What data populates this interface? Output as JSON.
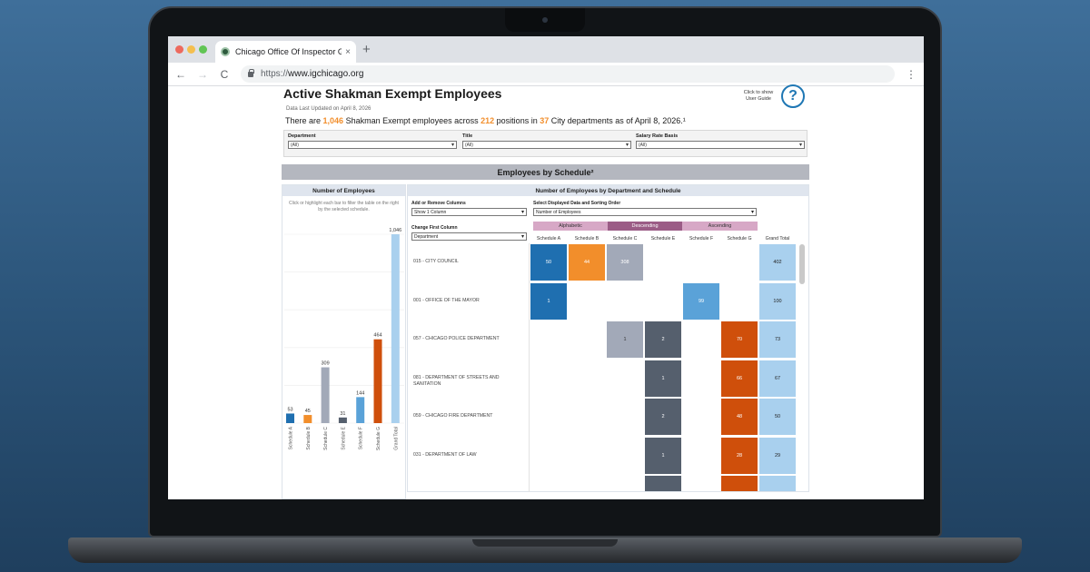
{
  "browser": {
    "tab_title": "Chicago Office Of Inspector General",
    "url_scheme": "https://",
    "url_host": "www.igchicago.org",
    "new_tab": "+",
    "tab_close": "×",
    "back": "←",
    "forward": "→",
    "reload": "C",
    "menu": "⋮"
  },
  "page": {
    "title": "Active Shakman Exempt Employees",
    "updated": "Data Last Updated on April 8, 2026",
    "summary": {
      "pre": "There are ",
      "employees": "1,046",
      "mid1": " Shakman Exempt employees across ",
      "positions": "212",
      "mid2": " positions in ",
      "departments": "37",
      "post": " City departments as of April 8, 2026.¹"
    },
    "guide_text": "Click to show User Guide",
    "help_icon": "?"
  },
  "filters": [
    {
      "label": "Department",
      "value": "(All)"
    },
    {
      "label": "Title",
      "value": "(All)"
    },
    {
      "label": "Salary Rate Basis",
      "value": "(All)"
    }
  ],
  "section_title": "Employees by Schedule²",
  "left_panel": {
    "title": "Number of Employees",
    "note": "Click or highlight each bar to filter the table on the right by the selected schedule."
  },
  "chart_data": {
    "type": "bar",
    "categories": [
      "Schedule A",
      "Schedule B",
      "Schedule C",
      "Schedule E",
      "Schedule F",
      "Schedule G",
      "Grand Total"
    ],
    "values": [
      53,
      45,
      309,
      31,
      144,
      464,
      1046
    ],
    "labels": [
      "53",
      "45",
      "309",
      "31",
      "144",
      "464",
      "1,046"
    ],
    "colors": [
      "#1f6fb0",
      "#f28e2b",
      "#a2a9b8",
      "#555f6d",
      "#5aa2d8",
      "#cf4f0b",
      "#a9d0ee"
    ],
    "ylim": [
      0,
      1046
    ]
  },
  "right_panel": {
    "title": "Number of Employees by Department and Schedule",
    "add_remove_label": "Add or Remove Columns",
    "add_remove_value": "Show 1 Column",
    "sort_label": "Select Displayed Data and Sorting Order",
    "sort_value": "Number of Employees",
    "first_col_label": "Change First Column",
    "first_col_value": "Department",
    "sort_buttons": [
      "Alphabetic",
      "Descending",
      "Ascending"
    ],
    "columns": [
      "Schedule A",
      "Schedule B",
      "Schedule C",
      "Schedule E",
      "Schedule F",
      "Schedule G",
      "Grand Total"
    ],
    "rows": [
      {
        "label": "015 - CITY COUNCIL",
        "values": [
          "50",
          "44",
          "308",
          "",
          "",
          "",
          "402"
        ]
      },
      {
        "label": "001 - OFFICE OF THE MAYOR",
        "values": [
          "1",
          "",
          "",
          "",
          "99",
          "",
          "100"
        ]
      },
      {
        "label": "057 - CHICAGO POLICE DEPARTMENT",
        "values": [
          "",
          "",
          "1",
          "2",
          "",
          "70",
          "73"
        ]
      },
      {
        "label": "081 - DEPARTMENT OF STREETS AND SANITATION",
        "values": [
          "",
          "",
          "",
          "1",
          "",
          "66",
          "67"
        ]
      },
      {
        "label": "059 - CHICAGO FIRE DEPARTMENT",
        "values": [
          "",
          "",
          "",
          "2",
          "",
          "48",
          "50"
        ]
      },
      {
        "label": "031 - DEPARTMENT OF LAW",
        "values": [
          "",
          "",
          "",
          "1",
          "",
          "28",
          "29"
        ]
      },
      {
        "label": "",
        "values": [
          "",
          "",
          "",
          "",
          "",
          "",
          ""
        ]
      }
    ]
  }
}
